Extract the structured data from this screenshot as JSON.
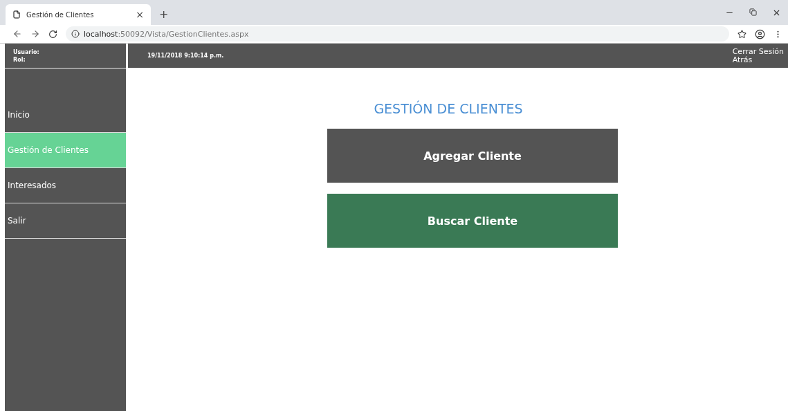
{
  "browser": {
    "tab_title": "Gestión de Clientes",
    "tab_close": "×",
    "new_tab": "+",
    "url_host": "localhost",
    "url_path": ":50092/Vista/GestionClientes.aspx"
  },
  "user_panel": {
    "user_label": "Usuario:",
    "role_label": "Rol:"
  },
  "header": {
    "datetime": "19/11/2018 9:10:14 p.m.",
    "logout": "Cerrar Sesión",
    "back": "Atrás"
  },
  "sidebar": {
    "items": [
      {
        "label": "Inicio",
        "selected": false
      },
      {
        "label": "Gestión de Clientes",
        "selected": true
      },
      {
        "label": "Interesados",
        "selected": false
      },
      {
        "label": "Salir",
        "selected": false
      }
    ]
  },
  "main": {
    "title": "GESTIÓN DE CLIENTES",
    "buttons": [
      {
        "label": "Agregar Cliente",
        "kind": "primary"
      },
      {
        "label": "Buscar Cliente",
        "kind": "secondary"
      }
    ]
  }
}
